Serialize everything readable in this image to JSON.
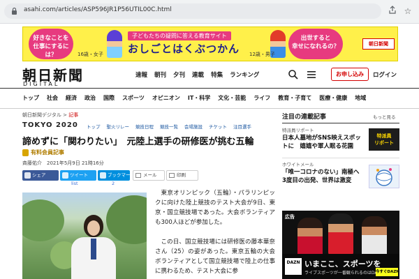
{
  "browser": {
    "url": "asahi.com/articles/ASP596JR1P56UTIL00C.html",
    "share_icon": "share-icon",
    "star_icon": "star-icon"
  },
  "top_ad": {
    "left_text": "好きなことを\n仕事にするには？",
    "left_caption": "16歳・女子",
    "sub_title": "子どもたちの疑問に答える教育サイト",
    "main_title": "おしごとはくぶつかん",
    "right_text": "出世すると\n幸せになれるの？",
    "right_caption": "12歳・男子",
    "logo": "朝日新聞"
  },
  "header": {
    "logo": "朝日新聞",
    "logo_sub": "DIGITAL",
    "nav": [
      "速報",
      "朝刊",
      "夕刊",
      "連載",
      "特集",
      "ランキング"
    ],
    "subscribe": "お申し込み",
    "login": "ログイン"
  },
  "categories": [
    "トップ",
    "社会",
    "経済",
    "政治",
    "国際",
    "スポーツ",
    "オピニオン",
    "IT・科学",
    "文化・芸能",
    "ライフ",
    "教育・子育て",
    "医療・健康",
    "地域"
  ],
  "article": {
    "breadcrumb_site": "朝日新聞デジタル",
    "breadcrumb_sep": ">",
    "breadcrumb_current": "記事",
    "event_logo": "TOKYO 2020",
    "topics": [
      "トップ",
      "聖火リレー",
      "競技日程",
      "競技一覧",
      "会場施設",
      "チケット",
      "注目選手"
    ],
    "headline": "諦めずに「関わりたい」　元陸上選手の研修医が挑む五輪",
    "member_badge": "有料会員記事",
    "byline": "斉藤佑介　2021年5月9日 21時16分",
    "share": {
      "facebook": "シェア",
      "twitter": "ツイート",
      "hatena": "ブックマーク",
      "mail": "メール",
      "print": "印刷",
      "twitter_count": "list",
      "hatena_count": "2"
    },
    "paragraph1": "東京オリンピック（五輪）・パラリンピックに向けた陸上競技のテスト大会が9日、東京・国立競技場であった。大会ボランティアも300人ほどが参加した。",
    "paragraph2": "この日、国立競技場には研修医の藤本華奈さん（25）の姿があった。東京五輪の大会ボランティアとして国立競技場で陸上の仕事に携わるため、テスト大会に参"
  },
  "sidebar": {
    "title": "注目の連載記事",
    "more": "もっと見る",
    "item1_label": "特派員リポート",
    "item1_text": "日本人墓地がSNS映えスポットに　嬉嬉や軍人眠る花園",
    "item1_thumb": "特派員\nリポート",
    "item2_label": "ホワイトメール",
    "item2_text": "「唯一コロナのない」南極へ　3度目の出発、世界は激変",
    "ad_label": "広告",
    "ad_brand": "DAZN",
    "ad_main": "いまここ、スポーツを",
    "ad_sub": "ライブスポーツが一番観られるのはDAZN",
    "ad_cta": "今すぐDAZNを視聴する"
  },
  "colors": {
    "accent": "#d40000",
    "link": "#1a56a0",
    "ad_yellow": "#fff04a"
  }
}
